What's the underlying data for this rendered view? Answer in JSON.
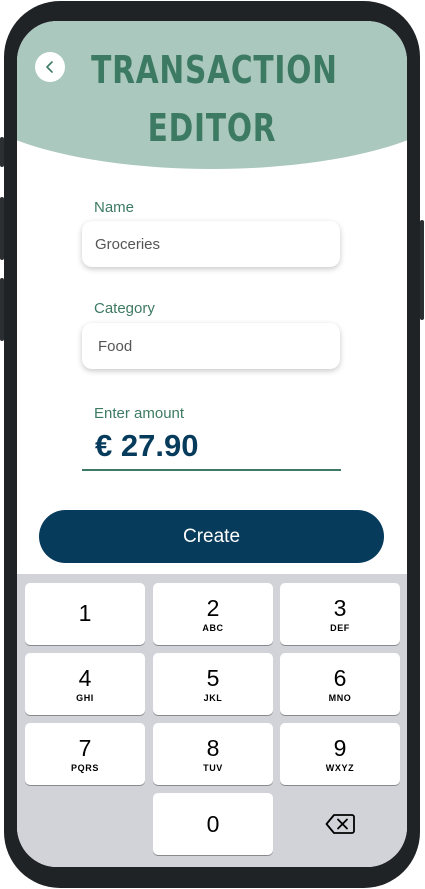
{
  "header": {
    "title_line1": "TRANSACTION",
    "title_line2": "EDITOR"
  },
  "form": {
    "name_label": "Name",
    "name_value": "Groceries",
    "category_label": "Category",
    "category_value": "Food",
    "amount_label": "Enter amount",
    "amount_value": "€ 27.90"
  },
  "actions": {
    "create_label": "Create"
  },
  "keypad": {
    "k1": {
      "digit": "1",
      "letters": ""
    },
    "k2": {
      "digit": "2",
      "letters": "ABC"
    },
    "k3": {
      "digit": "3",
      "letters": "DEF"
    },
    "k4": {
      "digit": "4",
      "letters": "GHI"
    },
    "k5": {
      "digit": "5",
      "letters": "JKL"
    },
    "k6": {
      "digit": "6",
      "letters": "MNO"
    },
    "k7": {
      "digit": "7",
      "letters": "PQRS"
    },
    "k8": {
      "digit": "8",
      "letters": "TUV"
    },
    "k9": {
      "digit": "9",
      "letters": "WXYZ"
    },
    "k0": {
      "digit": "0",
      "letters": ""
    }
  },
  "icons": {
    "back": "chevron-left-icon",
    "delete": "backspace-icon"
  },
  "colors": {
    "accent_green": "#3d7a63",
    "header_bg": "#aac8bd",
    "primary_navy": "#073b5c",
    "keypad_bg": "#d1d3d9"
  }
}
